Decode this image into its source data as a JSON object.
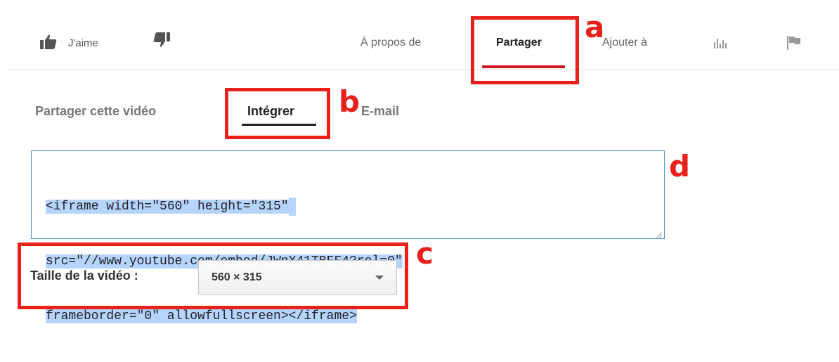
{
  "actions": {
    "like_label": "J'aime",
    "like_icon": "thumbs-up-icon",
    "dislike_icon": "thumbs-down-icon"
  },
  "tabs": [
    {
      "label": "À propos de",
      "active": false
    },
    {
      "label": "Partager",
      "active": true
    },
    {
      "label": "Ajouter à",
      "active": false
    }
  ],
  "tab_icons": [
    "stats-icon",
    "flag-icon"
  ],
  "share": {
    "subtabs": [
      {
        "label": "Partager cette vidéo",
        "active": false
      },
      {
        "label": "Intégrer",
        "active": true
      },
      {
        "label": "E-mail",
        "active": false
      }
    ],
    "embed_code": {
      "line1": "<iframe width=\"560\" height=\"315\"",
      "line2": "src=\"//www.youtube.com/embed/JWnX41TBFF4?rel=0\"",
      "line3": "frameborder=\"0\" allowfullscreen></iframe>"
    },
    "video_size": {
      "label": "Taille de la vidéo :",
      "selected": "560 × 315"
    }
  },
  "annotations": {
    "a": "a",
    "b": "b",
    "c": "c",
    "d": "d",
    "color": "#e8211b"
  },
  "colors": {
    "active_tab_underline": "#cc181e",
    "selection": "#b5d5ff",
    "textarea_border": "#4a8fd8"
  }
}
